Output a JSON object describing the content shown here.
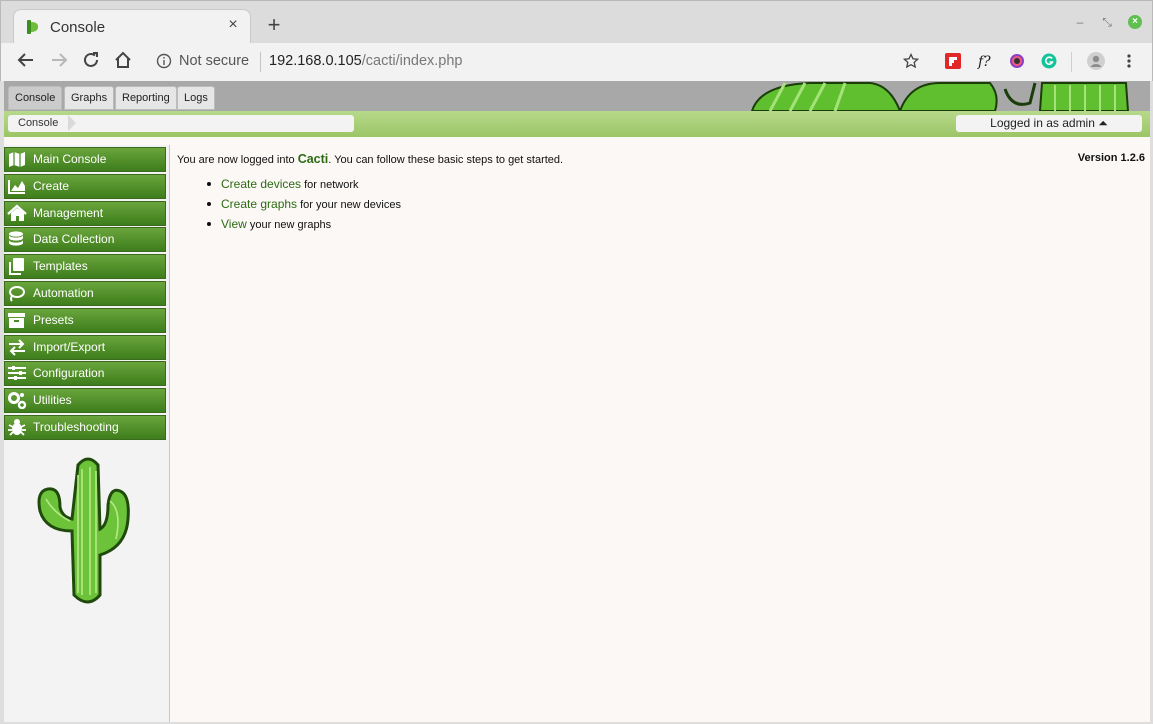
{
  "browser": {
    "tab_title": "Console",
    "tab_close": "×",
    "new_tab": "+",
    "not_secure": "Not secure",
    "url_host": "192.168.0.105",
    "url_path": "/cacti/index.php",
    "win_min": "–",
    "win_restore": "⤡",
    "win_close": "×"
  },
  "app": {
    "tabs": [
      "Console",
      "Graphs",
      "Reporting",
      "Logs"
    ],
    "breadcrumb": "Console",
    "logged_in": "Logged in as admin ⏶",
    "menu": [
      {
        "label": "Main Console",
        "icon": "map-icon"
      },
      {
        "label": "Create",
        "icon": "chart-icon"
      },
      {
        "label": "Management",
        "icon": "home-icon"
      },
      {
        "label": "Data Collection",
        "icon": "database-icon"
      },
      {
        "label": "Templates",
        "icon": "copy-icon"
      },
      {
        "label": "Automation",
        "icon": "lasso-icon"
      },
      {
        "label": "Presets",
        "icon": "archive-icon"
      },
      {
        "label": "Import/Export",
        "icon": "exchange-icon"
      },
      {
        "label": "Configuration",
        "icon": "sliders-icon"
      },
      {
        "label": "Utilities",
        "icon": "cogs-icon"
      },
      {
        "label": "Troubleshooting",
        "icon": "bug-icon"
      }
    ],
    "intro_before": "You are now logged into ",
    "intro_brand": "Cacti",
    "intro_after": ". You can follow these basic steps to get started.",
    "version": "Version 1.2.6",
    "steps": [
      {
        "link": "Create devices",
        "text": " for network"
      },
      {
        "link": "Create graphs",
        "text": " for your new devices"
      },
      {
        "link": "View",
        "text": " your new graphs"
      }
    ]
  },
  "colors": {
    "menu_green_top": "#6aa53c",
    "menu_green_bottom": "#3e7d1c",
    "link_green": "#2c6b12"
  }
}
